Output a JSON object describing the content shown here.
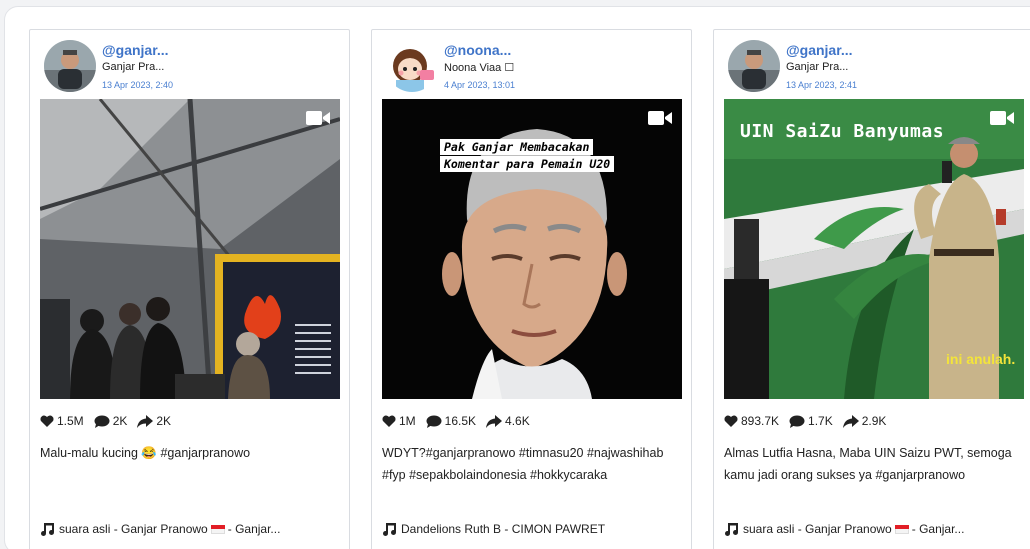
{
  "cards": [
    {
      "handle": "@ganjar...",
      "display_name": "Ganjar Pra...",
      "date": "13 Apr 2023, 2:40",
      "likes": "1.5M",
      "comments": "2K",
      "shares": "2K",
      "caption": "Malu-malu kucing 😂 #ganjarpranowo",
      "music_a": "suara asli - Ganjar Pranowo",
      "music_b": "- Ganjar..."
    },
    {
      "handle": "@noona...",
      "display_name": "Noona Viaa ☐",
      "date": "4 Apr 2023, 13:01",
      "likes": "1M",
      "comments": "16.5K",
      "shares": "4.6K",
      "caption": "WDYT?#ganjarpranowo #timnasu20 #najwashihab #fyp #sepakbolaindonesia #hokkycaraka",
      "music_a": "Dandelions Ruth B - CIMON PAWRET",
      "video_overlay_line1": "Pak Ganjar Membacakan",
      "video_overlay_line2": "Komentar para Pemain U20"
    },
    {
      "handle": "@ganjar...",
      "display_name": "Ganjar Pra...",
      "date": "13 Apr 2023, 2:41",
      "likes": "893.7K",
      "comments": "1.7K",
      "shares": "2.9K",
      "caption": "Almas Lutfia Hasna, Maba UIN Saizu PWT, semoga kamu jadi orang sukses ya #ganjarpranowo",
      "music_a": "suara asli - Ganjar Pranowo",
      "music_b": "- Ganjar...",
      "video_overlay_top": "UIN SaiZu Banyumas",
      "video_overlay_bottom": "ini anulah."
    }
  ],
  "icons": {
    "like": "heart-icon",
    "comment": "comment-icon",
    "share": "share-icon",
    "music": "music-note-icon",
    "video": "video-camera-icon"
  },
  "colors": {
    "handle": "#3f74c8",
    "date": "#4a7fd0",
    "flag_red": "#e21e26"
  }
}
